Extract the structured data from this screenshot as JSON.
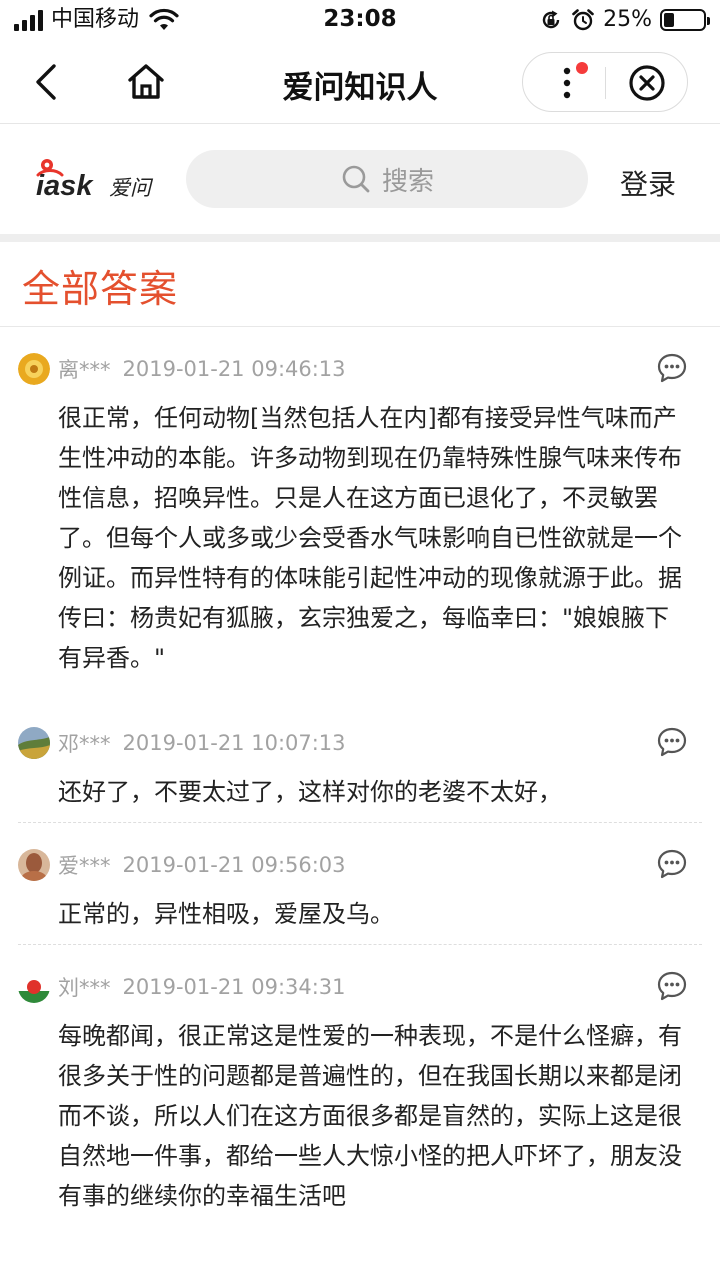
{
  "status_bar": {
    "carrier": "中国移动",
    "time": "23:08",
    "battery_pct": "25%",
    "battery_level": 0.25,
    "icons": [
      "signal-icon",
      "wifi-icon",
      "rotation-lock-icon",
      "alarm-icon",
      "battery-icon"
    ]
  },
  "nav": {
    "title": "爱问知识人",
    "icons": [
      "back-arrow-icon",
      "home-icon",
      "more-icon",
      "close-icon"
    ],
    "badge_color": "#f53b3b"
  },
  "header": {
    "logo_brand": "iask",
    "logo_text": "爱问",
    "search_placeholder": "搜索",
    "login_label": "登录"
  },
  "section": {
    "title": "全部答案",
    "accent_color": "#e4502e"
  },
  "answers": [
    {
      "user": "离***",
      "time": "2019-01-21 09:46:13",
      "text": "很正常，任何动物[当然包括人在内]都有接受异性气味而产生性冲动的本能。许多动物到现在仍靠特殊性腺气味来传布性信息，招唤异性。只是人在这方面已退化了，不灵敏罢了。但每个人或多或少会受香水气味影响自已性欲就是一个例证。而异性特有的体味能引起性冲动的现像就源于此。据传曰：杨贵妃有狐腋，玄宗独爱之，每临幸曰：\"娘娘腋下有异香。\""
    },
    {
      "user": "邓***",
      "time": "2019-01-21 10:07:13",
      "text": "还好了，不要太过了，这样对你的老婆不太好，"
    },
    {
      "user": "爱***",
      "time": "2019-01-21 09:56:03",
      "text": "正常的，异性相吸，爱屋及乌。"
    },
    {
      "user": "刘***",
      "time": "2019-01-21 09:34:31",
      "text": "每晚都闻，很正常这是性爱的一种表现，不是什么怪癖，有很多关于性的问题都是普遍性的，但在我国长期以来都是闭而不谈，所以人们在这方面很多都是盲然的，实际上这是很自然地一件事，都给一些人大惊小怪的把人吓坏了，朋友没有事的继续你的幸福生活吧"
    }
  ]
}
